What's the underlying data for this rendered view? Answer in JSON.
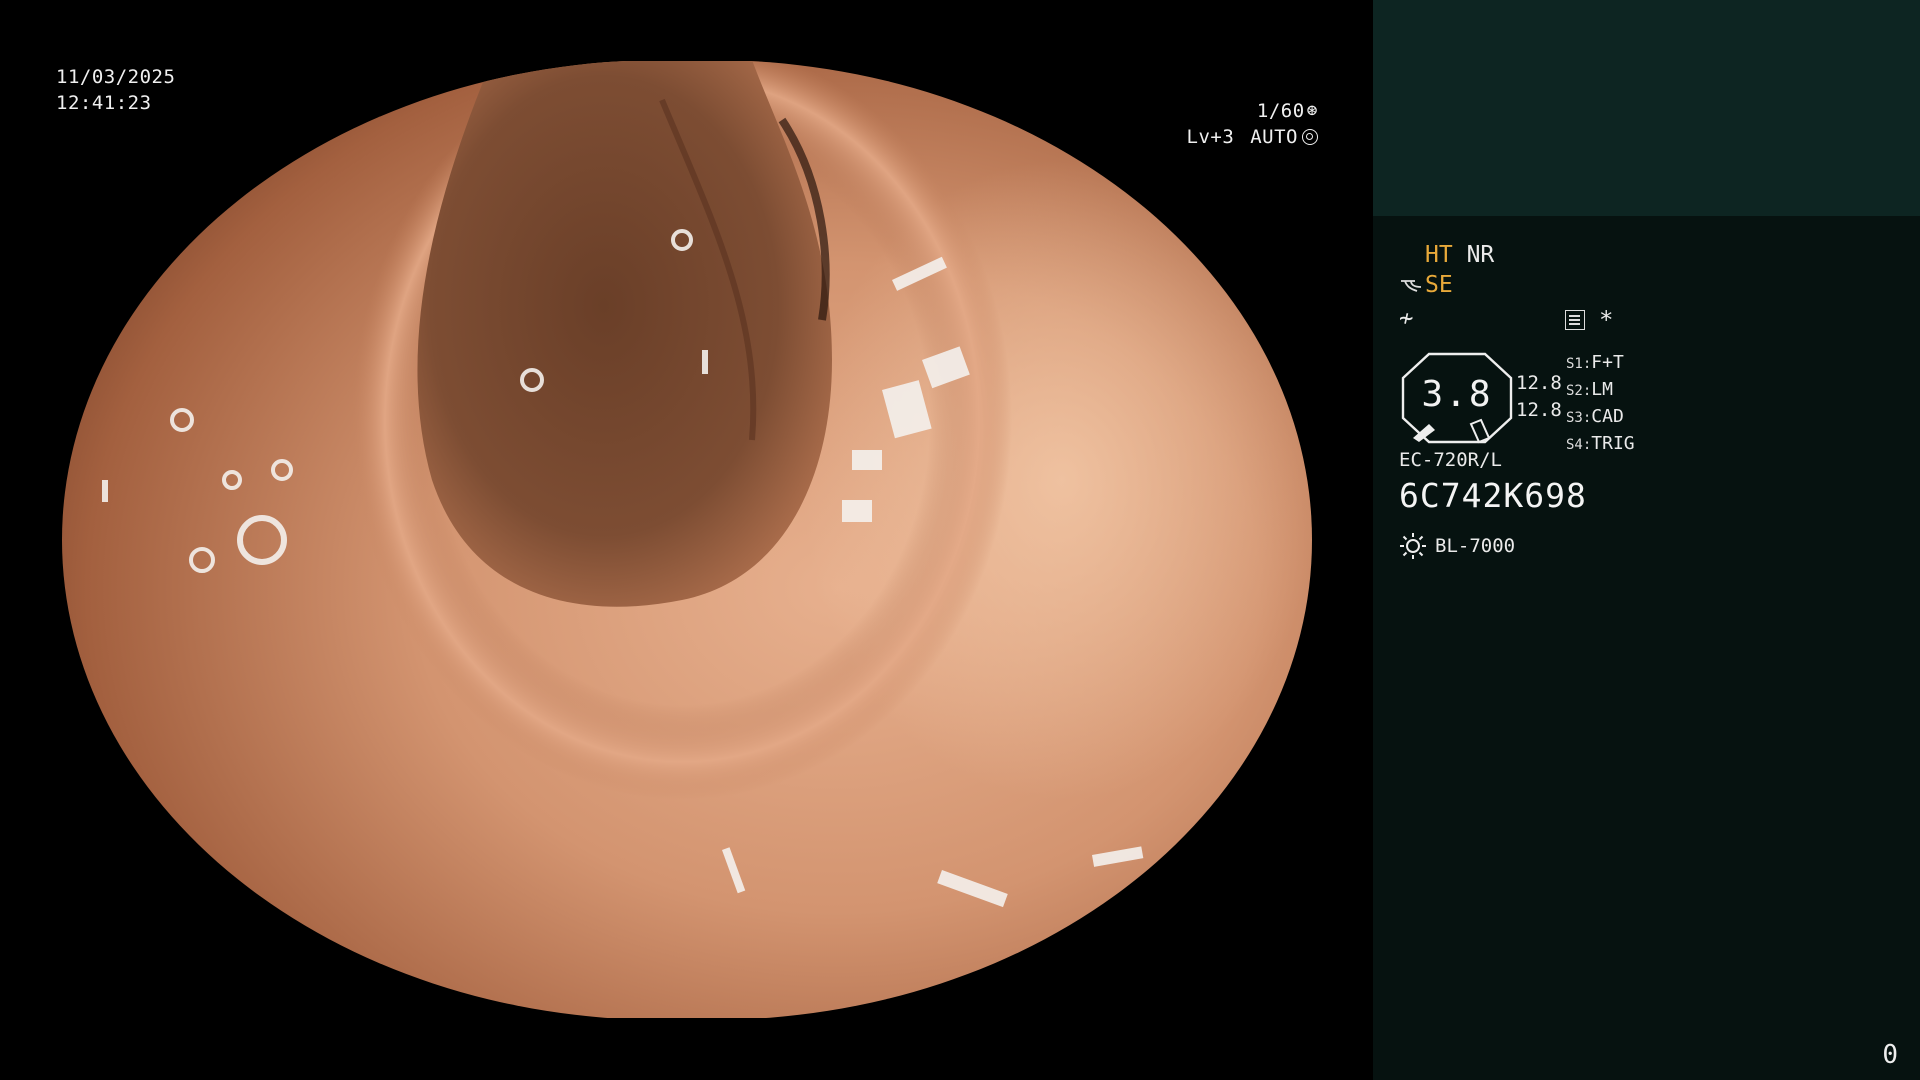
{
  "osd": {
    "date": "11/03/2025",
    "time": "12:41:23",
    "shutter": "1/60",
    "shutter_icon": "aperture-icon",
    "level": "Lv+3",
    "iris": "AUTO",
    "iris_icon": "iris-icon"
  },
  "panel": {
    "ht": "HT",
    "nr": "NR",
    "se": "SE",
    "se_icon": "swirl-icon",
    "enh_icon": "not-equal-icon",
    "enh_symbol": "≁",
    "asterisk": "*",
    "list_icon": "document-icon",
    "gauge_value": "3.8",
    "gauge_num_1": "12.8",
    "gauge_num_2": "12.8",
    "modes": [
      {
        "key": "S1:",
        "value": "F+T"
      },
      {
        "key": "S2:",
        "value": "LM"
      },
      {
        "key": "S3:",
        "value": "CAD"
      },
      {
        "key": "S4:",
        "value": "TRIG"
      }
    ],
    "scope_model": "EC-720R/L",
    "serial": "6C742K698",
    "light_icon": "sun-icon",
    "light_source": "BL-7000",
    "counter": "0"
  },
  "colors": {
    "panel_top": "#0d2522",
    "panel_bg": "#061210",
    "accent_yellow": "#e8a93a",
    "tissue": "#c98a66"
  }
}
